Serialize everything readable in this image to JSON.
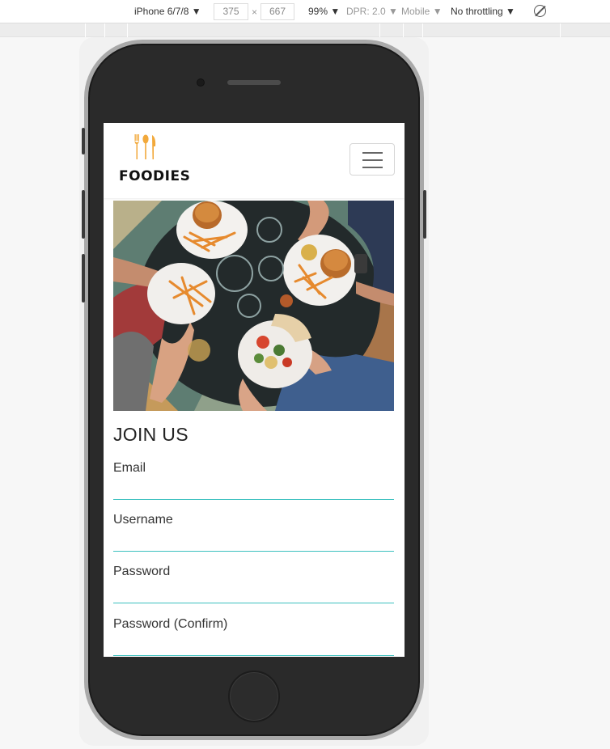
{
  "devtools": {
    "device": "iPhone 6/7/8",
    "device_caret": "▼",
    "width": "375",
    "times": "×",
    "height": "667",
    "zoom": "99%",
    "dpr": "DPR: 2.0",
    "mode": "Mobile",
    "throttling": "No throttling",
    "rotate_icon": "rotate-icon"
  },
  "navbar": {
    "brand": "FOODIES",
    "logo_icon": "utensils-icon",
    "menu_icon": "hamburger-icon"
  },
  "hero": {
    "image": "people-eating-burgers-and-fries-photo"
  },
  "form": {
    "title": "JOIN US",
    "fields": [
      {
        "label": "Email"
      },
      {
        "label": "Username"
      },
      {
        "label": "Password"
      },
      {
        "label": "Password (Confirm)"
      }
    ],
    "accent_color": "#3cc1bf"
  }
}
